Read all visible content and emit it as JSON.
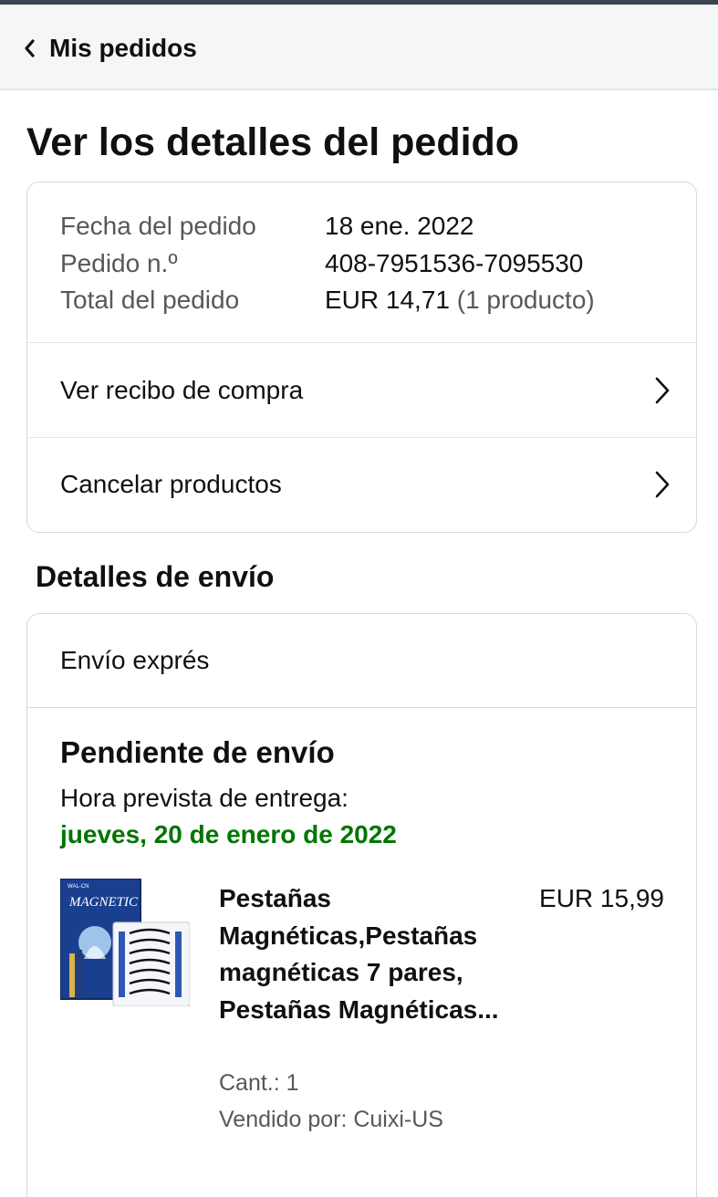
{
  "nav": {
    "back_label": "Mis pedidos"
  },
  "page_title": "Ver los detalles del pedido",
  "order_summary": {
    "date_label": "Fecha del pedido",
    "date_value": "18 ene. 2022",
    "number_label": "Pedido n.º",
    "number_value": "408-7951536-7095530",
    "total_label": "Total del pedido",
    "total_value": "EUR 14,71",
    "total_count": "(1 producto)"
  },
  "actions": [
    {
      "label": "Ver recibo de compra",
      "icon": "chevron-right-icon"
    },
    {
      "label": "Cancelar productos",
      "icon": "chevron-right-icon"
    }
  ],
  "shipping": {
    "section_title": "Detalles de envío",
    "method": "Envío exprés",
    "status": "Pendiente de envío",
    "eta_label": "Hora prevista de entrega:",
    "eta_date": "jueves, 20 de enero de 2022",
    "eta_color": "#007600",
    "item": {
      "image_text": "MAGNETIC",
      "image_brand": "WAL-CN",
      "name": "Pestañas Magnéticas,Pestañas magnéticas 7 pares, Pestañas Magnéticas...",
      "price": "EUR 15,99",
      "quantity": "Cant.: 1",
      "seller": "Vendido por: Cuixi-US"
    }
  }
}
